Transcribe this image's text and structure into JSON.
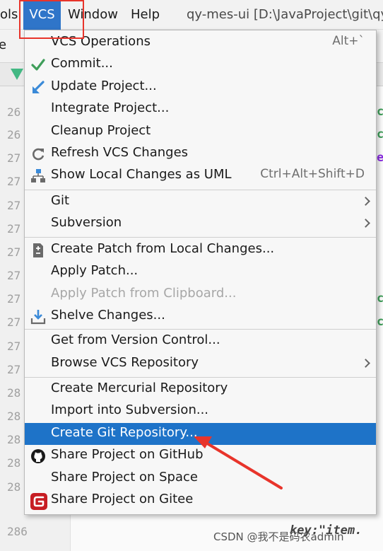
{
  "menubar": {
    "tools_label": "ols",
    "vcs_label": "VCS",
    "window_label": "Window",
    "help_label": "Help",
    "title": "qy-mes-ui [D:\\JavaProject\\git\\qy"
  },
  "background": {
    "second_bar_text": "e",
    "line_numbers": [
      "26",
      "26",
      "27",
      "27",
      "27",
      "27",
      "27",
      "27",
      "27",
      "27",
      "27",
      "27",
      "28",
      "28",
      "28",
      "28",
      "28",
      "286"
    ],
    "code_bottom": "key:\"item.",
    "watermark": "CSDN @我不是码农admin"
  },
  "vcs_menu": {
    "items": [
      {
        "label": "VCS Operations",
        "shortcut": "Alt+`",
        "icon": ""
      },
      {
        "label": "Commit...",
        "icon": "commit-check-icon"
      },
      {
        "label": "Update Project...",
        "icon": "update-arrow-icon"
      },
      {
        "label": "Integrate Project...",
        "icon": ""
      },
      {
        "label": "Cleanup Project",
        "icon": ""
      },
      {
        "label": "Refresh VCS Changes",
        "icon": "refresh-icon"
      },
      {
        "label": "Show Local Changes as UML",
        "shortcut": "Ctrl+Alt+Shift+D",
        "icon": "uml-diagram-icon"
      },
      {
        "label": "Git",
        "submenu": true,
        "icon": ""
      },
      {
        "label": "Subversion",
        "submenu": true,
        "icon": ""
      },
      {
        "label": "Create Patch from Local Changes...",
        "icon": "patch-file-icon"
      },
      {
        "label": "Apply Patch...",
        "icon": ""
      },
      {
        "label": "Apply Patch from Clipboard...",
        "disabled": true,
        "icon": ""
      },
      {
        "label": "Shelve Changes...",
        "icon": "shelve-icon"
      },
      {
        "label": "Get from Version Control...",
        "icon": ""
      },
      {
        "label": "Browse VCS Repository",
        "submenu": true,
        "icon": ""
      },
      {
        "label": "Create Mercurial Repository",
        "icon": ""
      },
      {
        "label": "Import into Subversion...",
        "icon": ""
      },
      {
        "label": "Create Git Repository...",
        "selected": true,
        "icon": ""
      },
      {
        "label": "Share Project on GitHub",
        "icon": "github-icon"
      },
      {
        "label": "Share Project on Space",
        "icon": ""
      },
      {
        "label": "Share Project on Gitee",
        "icon": "gitee-icon"
      }
    ]
  },
  "colors": {
    "selection": "#1e73c8",
    "menu_bg": "#f7f7f7",
    "annotation_red": "#e8342b",
    "commit_green": "#3f9e5a",
    "update_blue": "#3a8ad8",
    "gitee_red": "#c71d23"
  }
}
